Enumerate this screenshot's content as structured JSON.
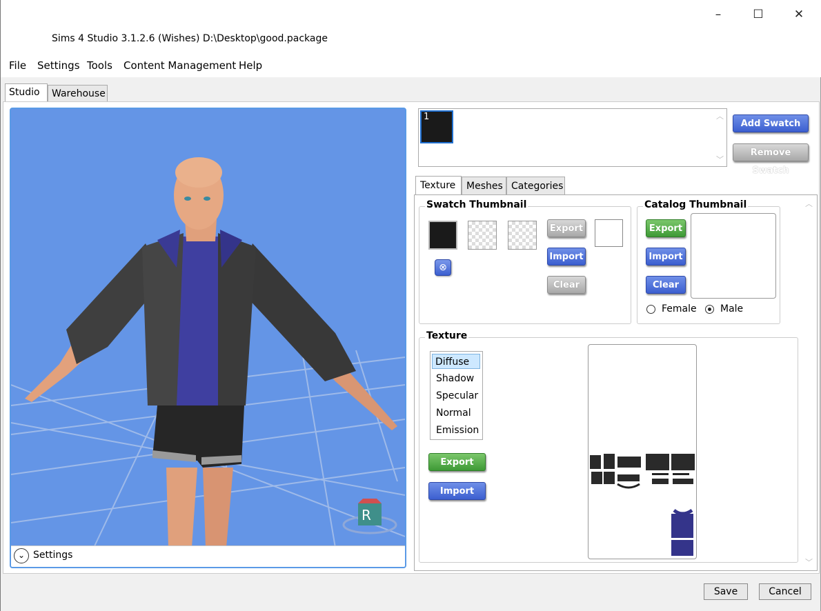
{
  "window": {
    "title": "Sims 4 Studio 3.1.2.6 (Wishes)  D:\\Desktop\\good.package",
    "minimize_icon": "–",
    "maximize_icon": "☐",
    "close_icon": "✕"
  },
  "menu": [
    "File",
    "Settings",
    "Tools",
    "Content Management",
    "Help"
  ],
  "top_tabs": [
    "Studio",
    "Warehouse"
  ],
  "viewport": {
    "settings_label": "Settings",
    "gizmo_label": "R"
  },
  "swatch_list": {
    "items": [
      {
        "label": "1",
        "color": "#1a1a1a"
      }
    ],
    "add_label": "Add Swatch",
    "remove_label": "Remove Swatch"
  },
  "sub_tabs": [
    "Texture",
    "Meshes",
    "Categories"
  ],
  "swatch_thumbnail": {
    "title": "Swatch Thumbnail",
    "export_label": "Export",
    "import_label": "Import",
    "clear_label": "Clear"
  },
  "catalog_thumbnail": {
    "title": "Catalog Thumbnail",
    "export_label": "Export",
    "import_label": "Import",
    "clear_label": "Clear",
    "gender_options": [
      "Female",
      "Male"
    ],
    "gender_selected": "Male"
  },
  "texture": {
    "title": "Texture",
    "channels": [
      "Diffuse",
      "Shadow",
      "Specular",
      "Normal",
      "Emission"
    ],
    "selected_channel": "Diffuse",
    "export_label": "Export",
    "import_label": "Import"
  },
  "footer": {
    "save_label": "Save",
    "cancel_label": "Cancel"
  },
  "colors": {
    "viewport_bg": "#6495e6",
    "accent_blue": "#3c5fd0",
    "accent_green": "#3e9a36",
    "jacket": "#3d3d3d",
    "shirt": "#3f3fa0"
  }
}
